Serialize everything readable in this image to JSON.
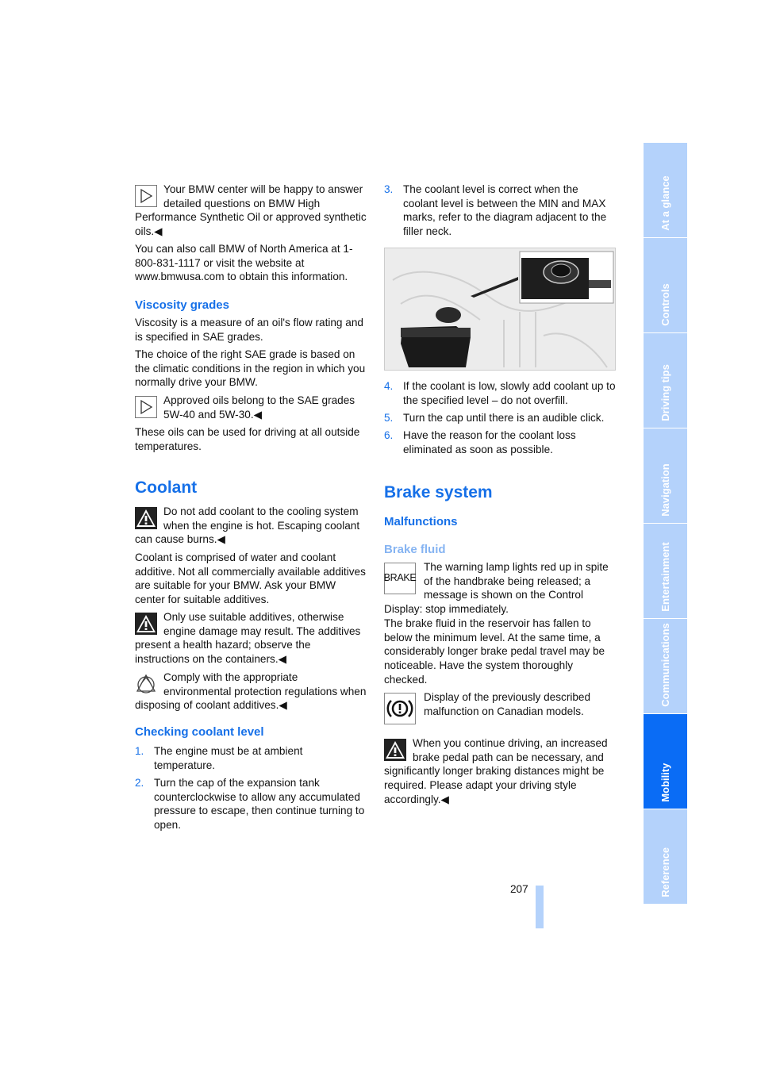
{
  "left": {
    "oil_note": "Your BMW center will be happy to answer detailed questions on BMW High Performance Synthetic Oil or approved synthetic oils.◀",
    "call_info": "You can also call BMW of North America at 1-800-831-1117 or visit the website at www.bmwusa.com to obtain this information.",
    "viscosity_heading": "Viscosity grades",
    "viscosity_p1": "Viscosity is a measure of an oil's flow rating and is specified in SAE grades.",
    "viscosity_p2": "The choice of the right SAE grade is based on the climatic conditions in the region in which you normally drive your BMW.",
    "viscosity_note": "Approved oils belong to the SAE grades 5W-40 and 5W-30.◀",
    "viscosity_p3": "These oils can be used for driving at all outside temperatures.",
    "coolant_heading": "Coolant",
    "coolant_warning1": "Do not add coolant to the cooling system when the engine is hot. Escaping coolant can cause burns.◀",
    "coolant_p1": "Coolant is comprised of water and coolant additive. Not all commercially available additives are suitable for your BMW. Ask your BMW center for suitable additives.",
    "coolant_warning2": "Only use suitable additives, otherwise engine damage may result. The additives present a health hazard; observe the instructions on the containers.◀",
    "coolant_env": "Comply with the appropriate environmental protection regulations when disposing of coolant additives.◀",
    "checking_heading": "Checking coolant level",
    "steps": [
      {
        "n": "1.",
        "text": "The engine must be at ambient temperature."
      },
      {
        "n": "2.",
        "text": "Turn the cap of the expansion tank counterclockwise to allow any accumulated pressure to escape, then continue turning to open."
      }
    ]
  },
  "right": {
    "step3": {
      "n": "3.",
      "text": "The coolant level is correct when the coolant level is between the MIN and MAX marks, refer to the diagram adjacent to the filler neck."
    },
    "steps": [
      {
        "n": "4.",
        "text": "If the coolant is low, slowly add coolant up to the specified level – do not overfill."
      },
      {
        "n": "5.",
        "text": "Turn the cap until there is an audible click."
      },
      {
        "n": "6.",
        "text": "Have the reason for the coolant loss eliminated as soon as possible."
      }
    ],
    "brake_heading": "Brake system",
    "malfunctions_heading": "Malfunctions",
    "brake_fluid_heading": "Brake fluid",
    "brake_lamp_label": "BRAKE",
    "brake_p1": "The warning lamp lights red up in spite of the handbrake being released; a message is shown on the Control Display: stop immediately.",
    "brake_p2": "The brake fluid in the reservoir has fallen to below the minimum level. At the same time, a considerably longer brake pedal travel may be noticeable. Have the system thoroughly checked.",
    "display_note": "Display of the previously described malfunction on Canadian models.",
    "brake_warning": "When you continue driving, an increased brake pedal path can be necessary, and significantly longer braking distances might be required. Please adapt your driving style accordingly.◀"
  },
  "tabs": [
    {
      "label": "At a glance",
      "active": false
    },
    {
      "label": "Controls",
      "active": false
    },
    {
      "label": "Driving tips",
      "active": false
    },
    {
      "label": "Navigation",
      "active": false
    },
    {
      "label": "Entertainment",
      "active": false
    },
    {
      "label": "Communications",
      "active": false
    },
    {
      "label": "Mobility",
      "active": true
    },
    {
      "label": "Reference",
      "active": false
    }
  ],
  "page_number": "207",
  "colors": {
    "heading": "#1670e8",
    "subheading_light": "#86b4f2",
    "tab": "#b4d2fb",
    "tab_active": "#0a6cf5"
  },
  "icons": {
    "note": "play-triangle-icon",
    "warning": "warning-triangle-icon",
    "environment": "recycle-icon",
    "brake_display": "brake-warning-circle-icon"
  }
}
